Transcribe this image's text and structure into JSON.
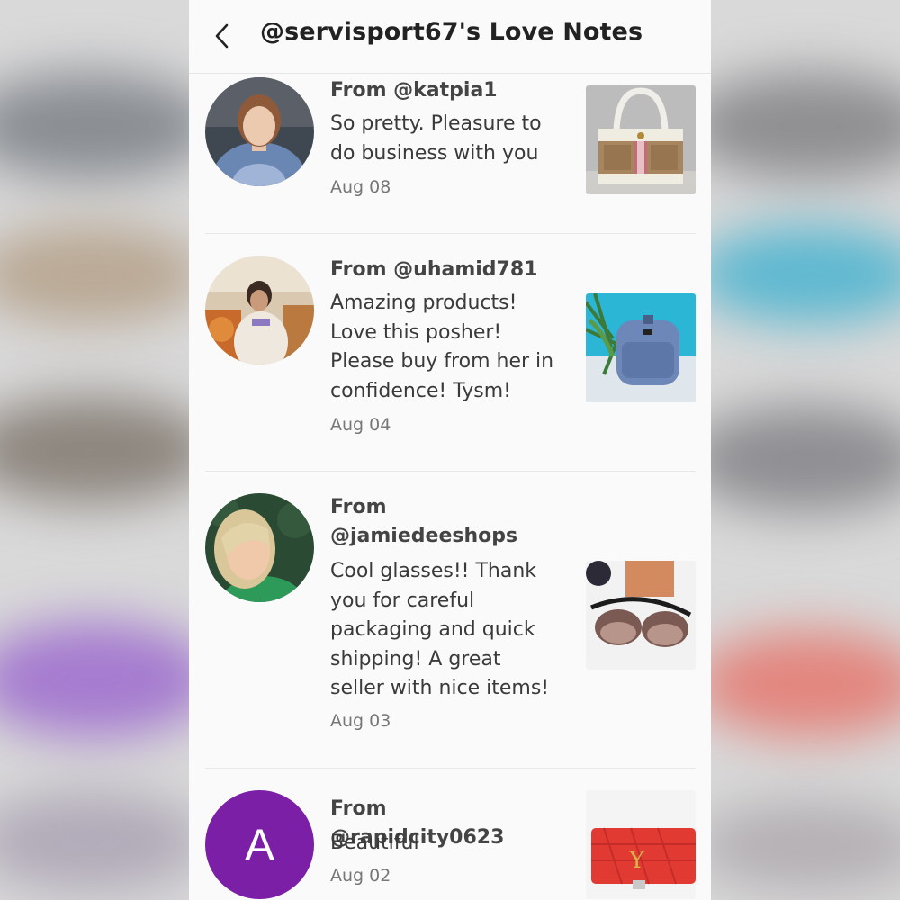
{
  "header": {
    "title": "@servisport67's Love Notes"
  },
  "notes": [
    {
      "from": "From @katpia1",
      "message": "So pretty. Pleasure to do business with you",
      "date": "Aug 08"
    },
    {
      "from": "From @uhamid781",
      "message": "Amazing products! Love this posher! Please buy from her in confidence! Tysm!",
      "date": "Aug 04"
    },
    {
      "from": "From @jamiedeeshops",
      "message": "Cool glasses!! Thank you for careful packaging and quick shipping! A great seller with nice items!",
      "date": "Aug 03"
    },
    {
      "from": "From @rapidcity0623",
      "message": "Beautiful",
      "date": "Aug 02",
      "avatar_letter": "A"
    }
  ],
  "colors": {
    "letter_avatar": "#7a1fa6",
    "divider": "#e8e8e8"
  }
}
